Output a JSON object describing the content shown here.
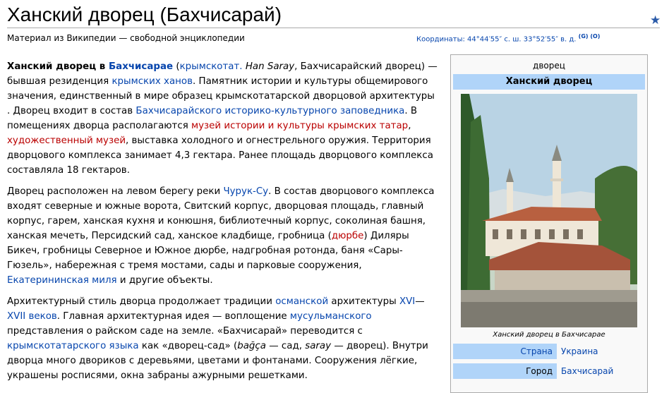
{
  "page": {
    "title": "Ханский дворец (Бахчисарай)",
    "subtitle": "Материал из Википедии — свободной энциклопедии",
    "coords_label": "Координаты: 44°44′55″ с. ш. 33°52′55″ в. д.",
    "coords_g": "(G)",
    "coords_o": "(O)"
  },
  "article": {
    "p1": {
      "b1": "Ханский дворец в ",
      "l_bakh": "Бахчисарае",
      "t1": " (",
      "l_crimtat": "крымскотат.",
      "t2": " ",
      "i_hansaray": "Han Saray",
      "t3": ", Бахчисарайский дворец) — бывшая резиденция ",
      "l_khans": "крымских ханов",
      "t4": ". Памятник истории и культуры общемирового значения, единственный в мире образец крымскотатарской дворцовой архитектуры . Дворец входит в состав ",
      "l_reserve": "Бахчисарайского историко-культурного заповедника",
      "t5": ". В помещениях дворца располагаются ",
      "l_museum1": "музей истории и культуры крымских татар",
      "t6": ", ",
      "l_museum2": "художественный музей",
      "t7": ", выставка холодного и огнестрельного оружия. Территория дворцового комплекса занимает 4,3 гектара. Ранее площадь дворцового комплекса составляла 18 гектаров."
    },
    "p2": {
      "t1": "Дворец расположен на левом берегу реки ",
      "l_river": "Чурук-Су",
      "t2": ". В состав дворцового комплекса входят северные и южные ворота, Свитский корпус, дворцовая площадь, главный корпус, гарем, ханская кухня и конюшня, библиотечный корпус, соколиная башня, ханская мечеть, Персидский сад, ханское кладбище, гробница (",
      "l_durbe": "дюрбе",
      "t3": ") Диляры Бикеч, гробницы Северное и Южное дюрбе, надгробная ротонда, баня «Сары-Гюзель», набережная с тремя мостами, сады и парковые сооружения, ",
      "l_mile": "Екатерининская миля",
      "t4": " и другие объекты."
    },
    "p3": {
      "t1": "Архитектурный стиль дворца продолжает традиции ",
      "l_ottoman": "османской",
      "t2": " архитектуры ",
      "l_xvi": "XVI",
      "t3": "—",
      "l_xvii": "XVII веков",
      "t4": ". Главная архитектурная идея — воплощение ",
      "l_muslim": "мусульманского",
      "t5": " представления о райском саде на земле. «Бахчисарай» переводится с ",
      "l_lang": "крымскотатарского языка",
      "t6": " как «дворец-сад» (",
      "i_bagca": "bağça",
      "t7": " — сад, ",
      "i_saray": "saray",
      "t8": " — дворец). Внутри дворца много двориков с деревьями, цветами и фонтанами. Сооружения лёгкие, украшены росписями, окна забраны ажурными решетками."
    }
  },
  "infobox": {
    "type": "дворец",
    "name": "Ханский дворец",
    "caption": "Ханский дворец в Бахчисарае",
    "rows": [
      {
        "label": "Страна",
        "value": "Украина"
      },
      {
        "label": "Город",
        "value": "Бахчисарай"
      }
    ]
  },
  "icons": {
    "star": "star-icon"
  },
  "colors": {
    "link": "#0645ad",
    "redlink": "#ba0000",
    "infobox_header": "#b0d4f9"
  }
}
